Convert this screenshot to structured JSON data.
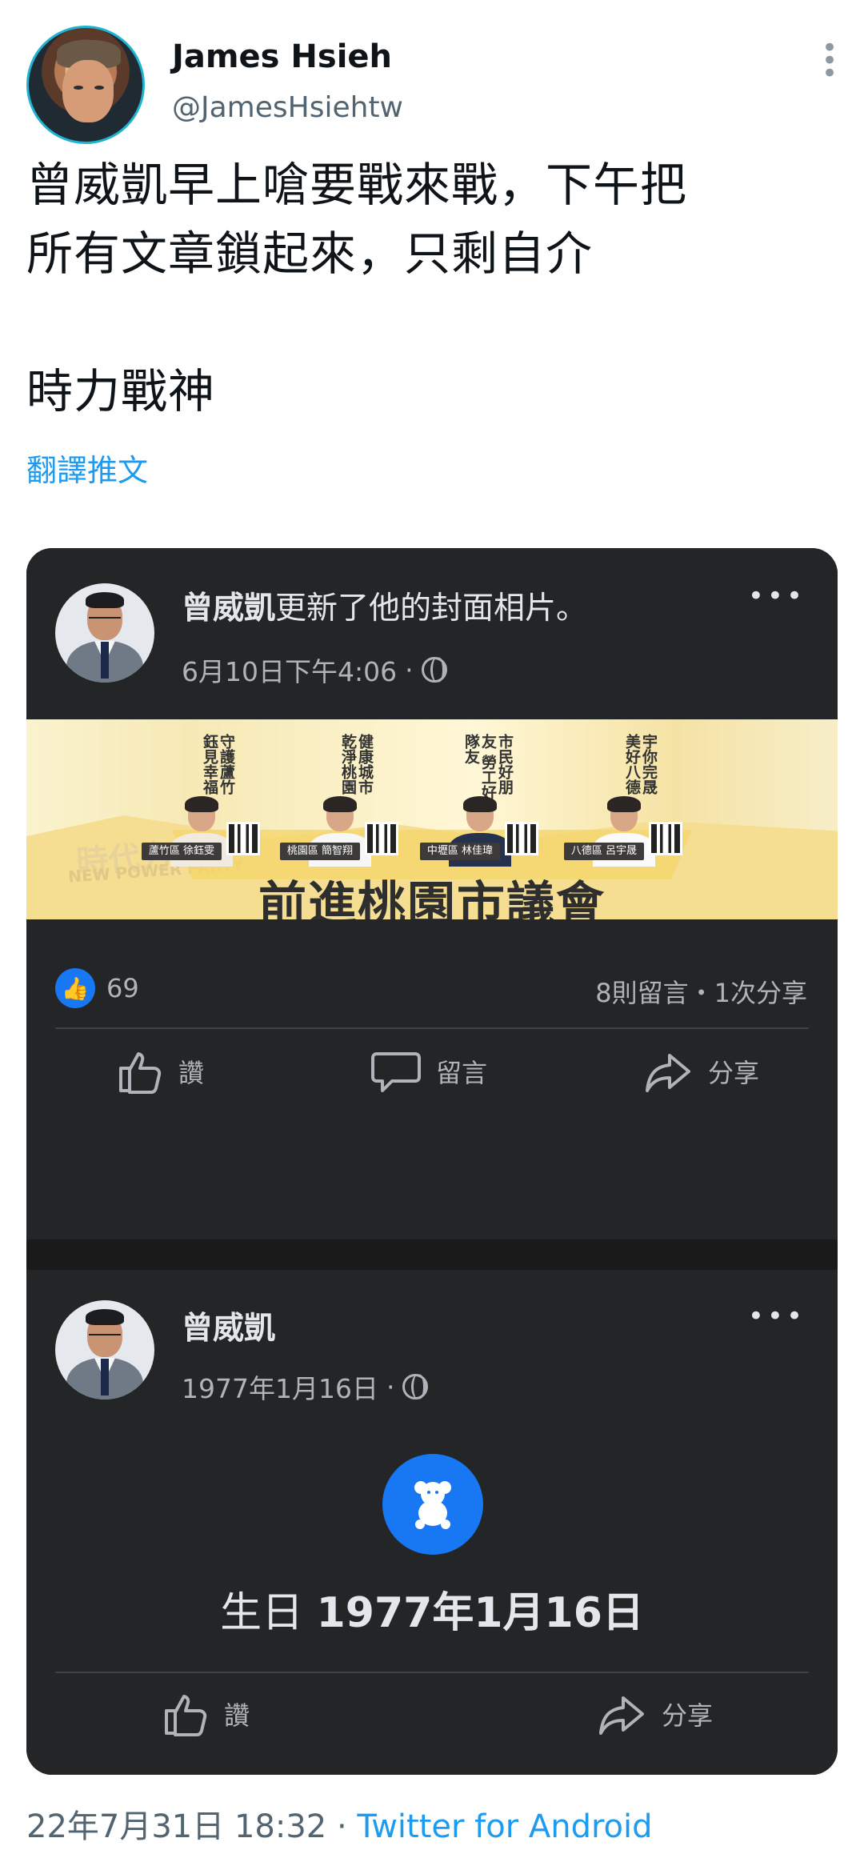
{
  "tweet": {
    "author_name": "James Hsieh",
    "author_handle": "@JamesHsiehtw",
    "text": "曾威凱早上嗆要戰來戰，下午把\n所有文章鎖起來，只剩自介\n\n時力戰神",
    "translate_label": "翻譯推文",
    "timestamp": "22年7月31日 18:32",
    "separator": " · ",
    "source": "Twitter for Android"
  },
  "embedded_post_1": {
    "name": "曾威凱",
    "action_text": "更新了他的封面相片。",
    "date": "6月10日下午4:06",
    "privacy_icon": "globe-icon",
    "likes": "69",
    "stats": "8則留言・1次分享",
    "buttons": {
      "like": "讚",
      "comment": "留言",
      "share": "分享"
    },
    "cover": {
      "watermark": "時代力",
      "watermark_sub": "NEW POWER PARTY",
      "headline": "前進桃園市議會",
      "candidates": [
        {
          "slogan": "守護蘆竹 鈺見幸福",
          "label": "蘆竹區 徐鈺雯"
        },
        {
          "slogan": "健康城市 乾淨桃園",
          "label": "桃園區 簡智翔"
        },
        {
          "slogan": "市民好朋友 勞工好隊友",
          "label": "中壢區 林佳瑋"
        },
        {
          "slogan": "宇你完晟 美好八德",
          "label": "八德區 呂宇晟"
        }
      ]
    }
  },
  "embedded_post_2": {
    "name": "曾威凱",
    "date": "1977年1月16日",
    "privacy_icon": "globe-icon",
    "birthday_label": "生日",
    "birthday_value": "1977年1月16日",
    "buttons": {
      "like": "讚",
      "share": "分享"
    }
  },
  "colors": {
    "twitter_blue": "#1d9bf0",
    "facebook_blue": "#1877f2",
    "card_background": "#242526",
    "muted_text": "#b0b3b8"
  }
}
